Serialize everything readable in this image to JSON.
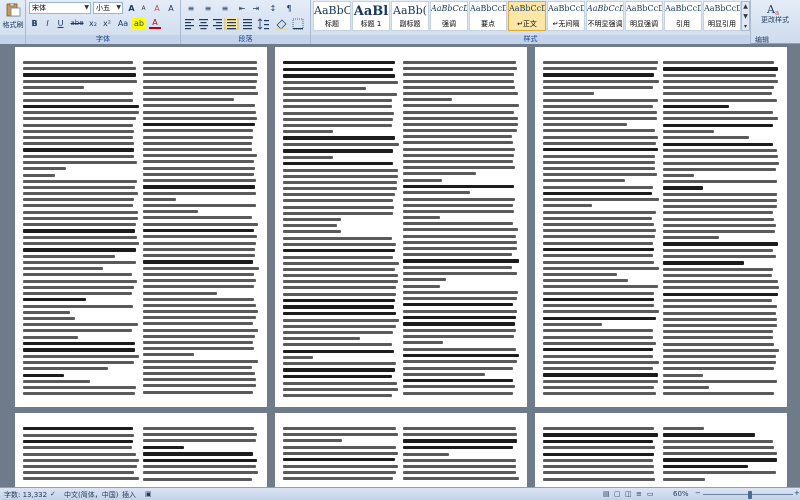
{
  "ribbon": {
    "clipboard": {
      "paste_label": "粘贴",
      "format_painter": "格式刷",
      "group_label": ""
    },
    "font": {
      "font_name": "宋体",
      "font_size": "小五",
      "grow": "A",
      "shrink": "A",
      "clear": "A",
      "bold": "B",
      "italic": "I",
      "underline": "U",
      "strike": "abe",
      "subscript": "x₂",
      "superscript": "x²",
      "change_case": "Aa",
      "highlight": "ab",
      "font_color": "A",
      "char_border": "A",
      "group_label": "字体"
    },
    "paragraph": {
      "bullets": "≡",
      "numbering": "≡",
      "multilevel": "≡",
      "decrease_indent": "⇤",
      "increase_indent": "⇥",
      "sort": "↕",
      "show_marks": "¶",
      "group_label": "段落"
    },
    "styles": {
      "group_label": "样式",
      "items": [
        {
          "sample": "AaBbCc",
          "name": "标题"
        },
        {
          "sample": "AaBl",
          "name": "标题 1"
        },
        {
          "sample": "AaBb(",
          "name": "副标题"
        },
        {
          "sample": "AaBbCcD",
          "name": "强调"
        },
        {
          "sample": "AaBbCcD",
          "name": "要点"
        },
        {
          "sample": "AaBbCcD",
          "name": "↵正文"
        },
        {
          "sample": "AaBbCcD",
          "name": "↵无间隔"
        },
        {
          "sample": "AaBbCcD",
          "name": "不明显强调"
        },
        {
          "sample": "AaBbCcD",
          "name": "明显强调"
        },
        {
          "sample": "AaBbCcD",
          "name": "引用"
        },
        {
          "sample": "AaBbCcD",
          "name": "明显引用"
        }
      ],
      "change_style": "更改样式"
    },
    "editing": {
      "edit_label": "编辑"
    }
  },
  "statusbar": {
    "word_count": "字数: 13,332",
    "language": "中文(简体，中国)",
    "insert_mode": "插入",
    "zoom_level": "60%",
    "zoom_fraction": 0.52
  },
  "colors": {
    "ribbon_text": "#1e395b",
    "page": "#ffffff",
    "workspace": "#6f7a8a",
    "accent": "#e2a93e"
  },
  "document": {
    "page_count_visible": 8
  }
}
